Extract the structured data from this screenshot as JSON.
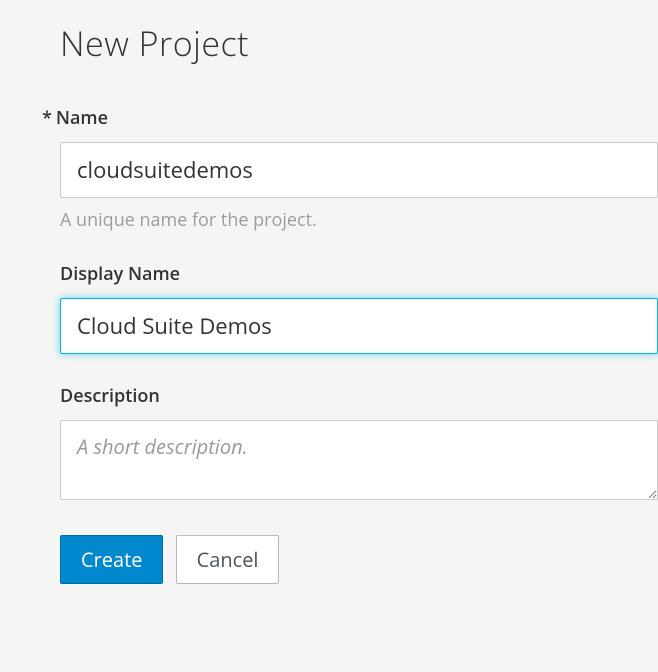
{
  "page": {
    "title": "New Project"
  },
  "form": {
    "name": {
      "required_marker": "*",
      "label": "Name",
      "value": "cloudsuitedemos",
      "help": "A unique name for the project."
    },
    "display_name": {
      "label": "Display Name",
      "value": "Cloud Suite Demos"
    },
    "description": {
      "label": "Description",
      "placeholder": "A short description.",
      "value": ""
    }
  },
  "buttons": {
    "create": "Create",
    "cancel": "Cancel"
  }
}
